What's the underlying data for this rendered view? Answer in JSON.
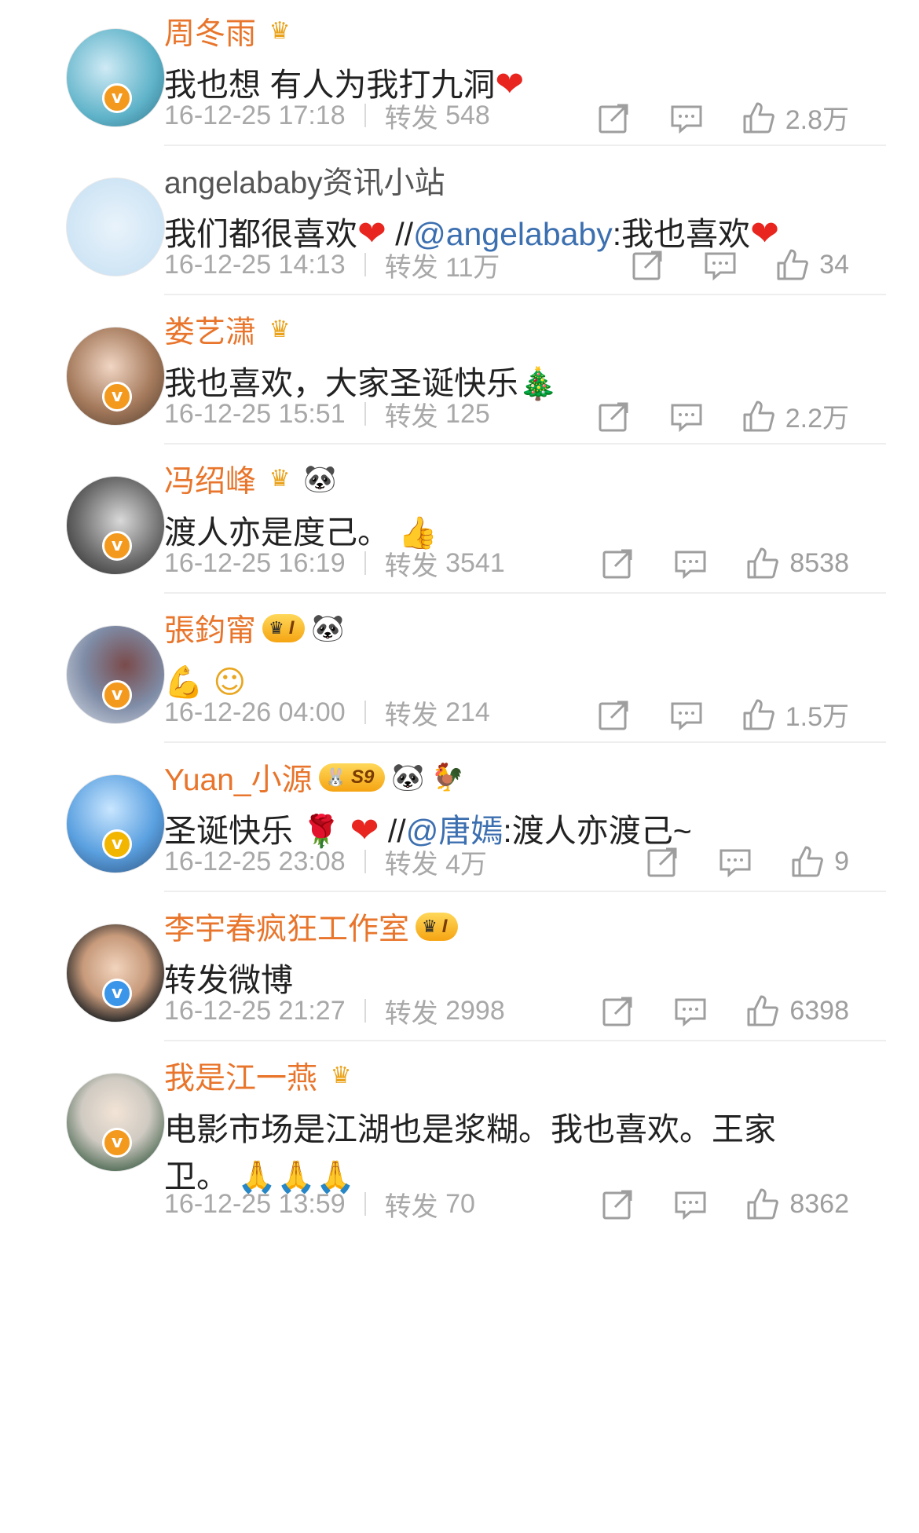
{
  "comments": [
    {
      "user": "周冬雨",
      "verified": "orange",
      "badges": [
        "crown"
      ],
      "text_parts": [
        {
          "t": "我也想 有人为我打九洞"
        }
      ],
      "emoji_after": "❤",
      "time": "16-12-25 17:18",
      "repost_label": "转发",
      "repost_count": "548",
      "likes": "2.8万"
    },
    {
      "user": "angelababy资讯小站",
      "verified": "",
      "badges": [],
      "text_before": "我们都很喜欢",
      "text_link_prefix": "//",
      "mention": "@angelababy",
      "text_after": ":我也喜欢",
      "time": "16-12-25 14:13",
      "repost_label": "转发",
      "repost_count": "11万",
      "likes": "34"
    },
    {
      "user": "娄艺潇",
      "verified": "orange",
      "badges": [
        "crown"
      ],
      "text": "我也喜欢，大家圣诞快乐",
      "emoji_after": "🎄",
      "time": "16-12-25 15:51",
      "repost_label": "转发",
      "repost_count": "125",
      "likes": "2.2万"
    },
    {
      "user": "冯绍峰",
      "verified": "orange",
      "badges": [
        "crown",
        "panda"
      ],
      "text": "渡人亦是度己。",
      "emoji_after": "👍",
      "time": "16-12-25 16:19",
      "repost_label": "转发",
      "repost_count": "3541",
      "likes": "8538"
    },
    {
      "user": "張鈞甯",
      "verified": "orange",
      "badges": [
        "vip",
        "panda"
      ],
      "vip_label": "I",
      "text": "",
      "emoji_after": "💪 ☺",
      "time": "16-12-26 04:00",
      "repost_label": "转发",
      "repost_count": "214",
      "likes": "1.5万"
    },
    {
      "user": "Yuan_小源",
      "verified": "gold",
      "badges": [
        "s-level",
        "panda",
        "rooster"
      ],
      "level_label": "S9",
      "text_before": "圣诞快乐",
      "text_link_prefix": "//",
      "mention": "@唐嫣",
      "text_after": ":渡人亦渡己~",
      "time": "16-12-25 23:08",
      "repost_label": "转发",
      "repost_count": "4万",
      "likes": "9"
    },
    {
      "user": "李宇春疯狂工作室",
      "verified": "blue",
      "badges": [
        "vip"
      ],
      "vip_label": "I",
      "text": "转发微博",
      "time": "16-12-25 21:27",
      "repost_label": "转发",
      "repost_count": "2998",
      "likes": "6398"
    },
    {
      "user": "我是江一燕",
      "verified": "orange",
      "badges": [
        "crown"
      ],
      "text_line1": "电影市场是江湖也是浆糊。我也喜欢。王家",
      "text_line2": "卫。",
      "time": "16-12-25 13:59",
      "repost_label": "转发",
      "repost_count": "70",
      "likes": "8362"
    }
  ],
  "colors": {
    "username": "#e8752b",
    "plain_username": "#555555",
    "mention": "#3c6fb0",
    "meta": "#a8a8a8",
    "heart": "#e8251f"
  },
  "icons": {
    "share": "share-icon",
    "comment": "comment-icon",
    "like": "thumbs-up-icon"
  }
}
